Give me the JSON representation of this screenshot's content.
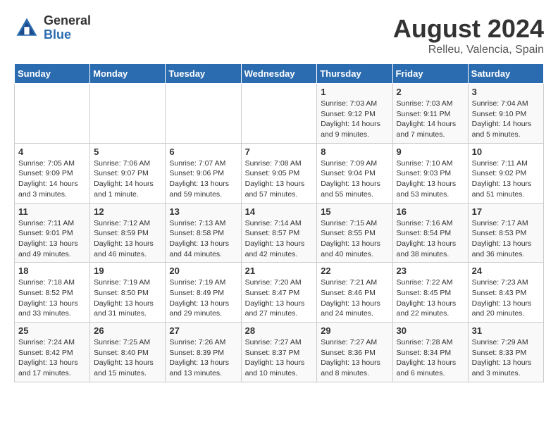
{
  "header": {
    "logo_general": "General",
    "logo_blue": "Blue",
    "title": "August 2024",
    "location": "Relleu, Valencia, Spain"
  },
  "weekdays": [
    "Sunday",
    "Monday",
    "Tuesday",
    "Wednesday",
    "Thursday",
    "Friday",
    "Saturday"
  ],
  "weeks": [
    [
      {
        "day": "",
        "info": ""
      },
      {
        "day": "",
        "info": ""
      },
      {
        "day": "",
        "info": ""
      },
      {
        "day": "",
        "info": ""
      },
      {
        "day": "1",
        "info": "Sunrise: 7:03 AM\nSunset: 9:12 PM\nDaylight: 14 hours and 9 minutes."
      },
      {
        "day": "2",
        "info": "Sunrise: 7:03 AM\nSunset: 9:11 PM\nDaylight: 14 hours and 7 minutes."
      },
      {
        "day": "3",
        "info": "Sunrise: 7:04 AM\nSunset: 9:10 PM\nDaylight: 14 hours and 5 minutes."
      }
    ],
    [
      {
        "day": "4",
        "info": "Sunrise: 7:05 AM\nSunset: 9:09 PM\nDaylight: 14 hours and 3 minutes."
      },
      {
        "day": "5",
        "info": "Sunrise: 7:06 AM\nSunset: 9:07 PM\nDaylight: 14 hours and 1 minute."
      },
      {
        "day": "6",
        "info": "Sunrise: 7:07 AM\nSunset: 9:06 PM\nDaylight: 13 hours and 59 minutes."
      },
      {
        "day": "7",
        "info": "Sunrise: 7:08 AM\nSunset: 9:05 PM\nDaylight: 13 hours and 57 minutes."
      },
      {
        "day": "8",
        "info": "Sunrise: 7:09 AM\nSunset: 9:04 PM\nDaylight: 13 hours and 55 minutes."
      },
      {
        "day": "9",
        "info": "Sunrise: 7:10 AM\nSunset: 9:03 PM\nDaylight: 13 hours and 53 minutes."
      },
      {
        "day": "10",
        "info": "Sunrise: 7:11 AM\nSunset: 9:02 PM\nDaylight: 13 hours and 51 minutes."
      }
    ],
    [
      {
        "day": "11",
        "info": "Sunrise: 7:11 AM\nSunset: 9:01 PM\nDaylight: 13 hours and 49 minutes."
      },
      {
        "day": "12",
        "info": "Sunrise: 7:12 AM\nSunset: 8:59 PM\nDaylight: 13 hours and 46 minutes."
      },
      {
        "day": "13",
        "info": "Sunrise: 7:13 AM\nSunset: 8:58 PM\nDaylight: 13 hours and 44 minutes."
      },
      {
        "day": "14",
        "info": "Sunrise: 7:14 AM\nSunset: 8:57 PM\nDaylight: 13 hours and 42 minutes."
      },
      {
        "day": "15",
        "info": "Sunrise: 7:15 AM\nSunset: 8:55 PM\nDaylight: 13 hours and 40 minutes."
      },
      {
        "day": "16",
        "info": "Sunrise: 7:16 AM\nSunset: 8:54 PM\nDaylight: 13 hours and 38 minutes."
      },
      {
        "day": "17",
        "info": "Sunrise: 7:17 AM\nSunset: 8:53 PM\nDaylight: 13 hours and 36 minutes."
      }
    ],
    [
      {
        "day": "18",
        "info": "Sunrise: 7:18 AM\nSunset: 8:52 PM\nDaylight: 13 hours and 33 minutes."
      },
      {
        "day": "19",
        "info": "Sunrise: 7:19 AM\nSunset: 8:50 PM\nDaylight: 13 hours and 31 minutes."
      },
      {
        "day": "20",
        "info": "Sunrise: 7:19 AM\nSunset: 8:49 PM\nDaylight: 13 hours and 29 minutes."
      },
      {
        "day": "21",
        "info": "Sunrise: 7:20 AM\nSunset: 8:47 PM\nDaylight: 13 hours and 27 minutes."
      },
      {
        "day": "22",
        "info": "Sunrise: 7:21 AM\nSunset: 8:46 PM\nDaylight: 13 hours and 24 minutes."
      },
      {
        "day": "23",
        "info": "Sunrise: 7:22 AM\nSunset: 8:45 PM\nDaylight: 13 hours and 22 minutes."
      },
      {
        "day": "24",
        "info": "Sunrise: 7:23 AM\nSunset: 8:43 PM\nDaylight: 13 hours and 20 minutes."
      }
    ],
    [
      {
        "day": "25",
        "info": "Sunrise: 7:24 AM\nSunset: 8:42 PM\nDaylight: 13 hours and 17 minutes."
      },
      {
        "day": "26",
        "info": "Sunrise: 7:25 AM\nSunset: 8:40 PM\nDaylight: 13 hours and 15 minutes."
      },
      {
        "day": "27",
        "info": "Sunrise: 7:26 AM\nSunset: 8:39 PM\nDaylight: 13 hours and 13 minutes."
      },
      {
        "day": "28",
        "info": "Sunrise: 7:27 AM\nSunset: 8:37 PM\nDaylight: 13 hours and 10 minutes."
      },
      {
        "day": "29",
        "info": "Sunrise: 7:27 AM\nSunset: 8:36 PM\nDaylight: 13 hours and 8 minutes."
      },
      {
        "day": "30",
        "info": "Sunrise: 7:28 AM\nSunset: 8:34 PM\nDaylight: 13 hours and 6 minutes."
      },
      {
        "day": "31",
        "info": "Sunrise: 7:29 AM\nSunset: 8:33 PM\nDaylight: 13 hours and 3 minutes."
      }
    ]
  ]
}
